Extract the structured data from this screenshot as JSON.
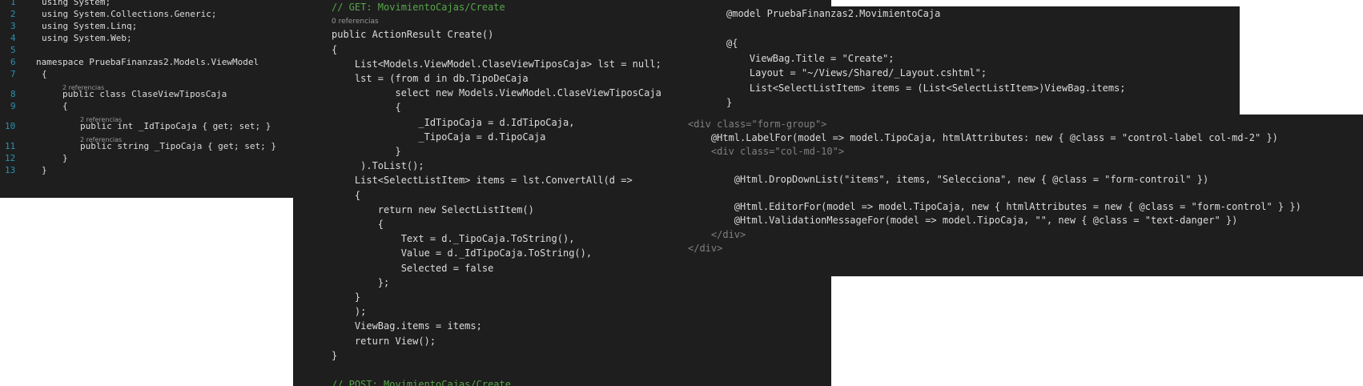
{
  "p1_lines": [
    {
      "n": "1",
      "t": "using System;"
    },
    {
      "n": "2",
      "t": "using System.Collections.Generic;"
    },
    {
      "n": "3",
      "t": "using System.Linq;"
    },
    {
      "n": "4",
      "t": "using System.Web;"
    },
    {
      "n": "5",
      "t": ""
    },
    {
      "n": "6",
      "t": "namespace PruebaFinanzas2.Models.ViewModel"
    },
    {
      "n": "7",
      "t": "{"
    },
    {
      "n": "",
      "t": "2 referencias",
      "ref": true
    },
    {
      "n": "8",
      "t": "public class ClaseViewTiposCaja"
    },
    {
      "n": "9",
      "t": "{"
    },
    {
      "n": "",
      "t": "2 referencias",
      "ref": true
    },
    {
      "n": "10",
      "t": "public int _IdTipoCaja { get; set; }"
    },
    {
      "n": "",
      "t": "2 referencias",
      "ref": true
    },
    {
      "n": "11",
      "t": "public string _TipoCaja { get; set; }"
    },
    {
      "n": "12",
      "t": "}"
    },
    {
      "n": "13",
      "t": "}"
    }
  ],
  "p2_lines": [
    "// GET: MovimientoCajas/Create",
    "0 referencias",
    "public ActionResult Create()",
    "{",
    "    List<Models.ViewModel.ClaseViewTiposCaja> lst = null;",
    "    lst = (from d in db.TipoDeCaja",
    "           select new Models.ViewModel.ClaseViewTiposCaja",
    "           {",
    "               _IdTipoCaja = d.IdTipoCaja,",
    "               _TipoCaja = d.TipoCaja",
    "           }",
    "     ).ToList();",
    "    List<SelectListItem> items = lst.ConvertAll(d =>",
    "    {",
    "        return new SelectListItem()",
    "        {",
    "            Text = d._TipoCaja.ToString(),",
    "            Value = d._IdTipoCaja.ToString(),",
    "            Selected = false",
    "        };",
    "    }",
    "    );",
    "    ViewBag.items = items;",
    "    return View();",
    "}",
    "",
    "// POST: MovimientoCajas/Create"
  ],
  "p3_lines": [
    "@model PruebaFinanzas2.MovimientoCaja",
    "",
    "@{",
    "    ViewBag.Title = \"Create\";",
    "    Layout = \"~/Views/Shared/_Layout.cshtml\";",
    "    List<SelectListItem> items = (List<SelectListItem>)ViewBag.items;",
    "}"
  ],
  "p4_lines": [
    "<div class=\"form-group\">",
    "    @Html.LabelFor(model => model.TipoCaja, htmlAttributes: new { @class = \"control-label col-md-2\" })",
    "    <div class=\"col-md-10\">",
    "",
    "        @Html.DropDownList(\"items\", items, \"Selecciona\", new { @class = \"form-controil\" })",
    "",
    "        @Html.EditorFor(model => model.TipoCaja, new { htmlAttributes = new { @class = \"form-control\" } })",
    "        @Html.ValidationMessageFor(model => model.TipoCaja, \"\", new { @class = \"text-danger\" })",
    "    </div>",
    "</div>"
  ]
}
